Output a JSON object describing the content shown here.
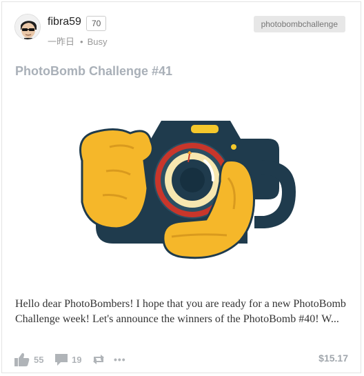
{
  "post": {
    "author": "fibra59",
    "reputation": "70",
    "time_ago": "一昨日",
    "status": "Busy",
    "tag": "photobombchallenge",
    "title": "PhotoBomb Challenge #41",
    "body": "Hello dear PhotoBombers! I hope that you are ready for a new PhotoBomb Challenge week! Let's announce the winners of the PhotoBomb #40! W..."
  },
  "footer": {
    "votes": "55",
    "comments": "19",
    "more_label": "•••",
    "payout": "$15.17"
  },
  "icons": {
    "upvote": "thumbs-up-icon",
    "comment": "comment-icon",
    "resteem": "resteem-icon",
    "more": "more-icon"
  },
  "colors": {
    "title": "#a9b0b8",
    "tag_bg": "#e7e7e7",
    "camera_body": "#1f3b4d",
    "hand": "#f5b72a",
    "lens_ring": "#c8362b"
  }
}
